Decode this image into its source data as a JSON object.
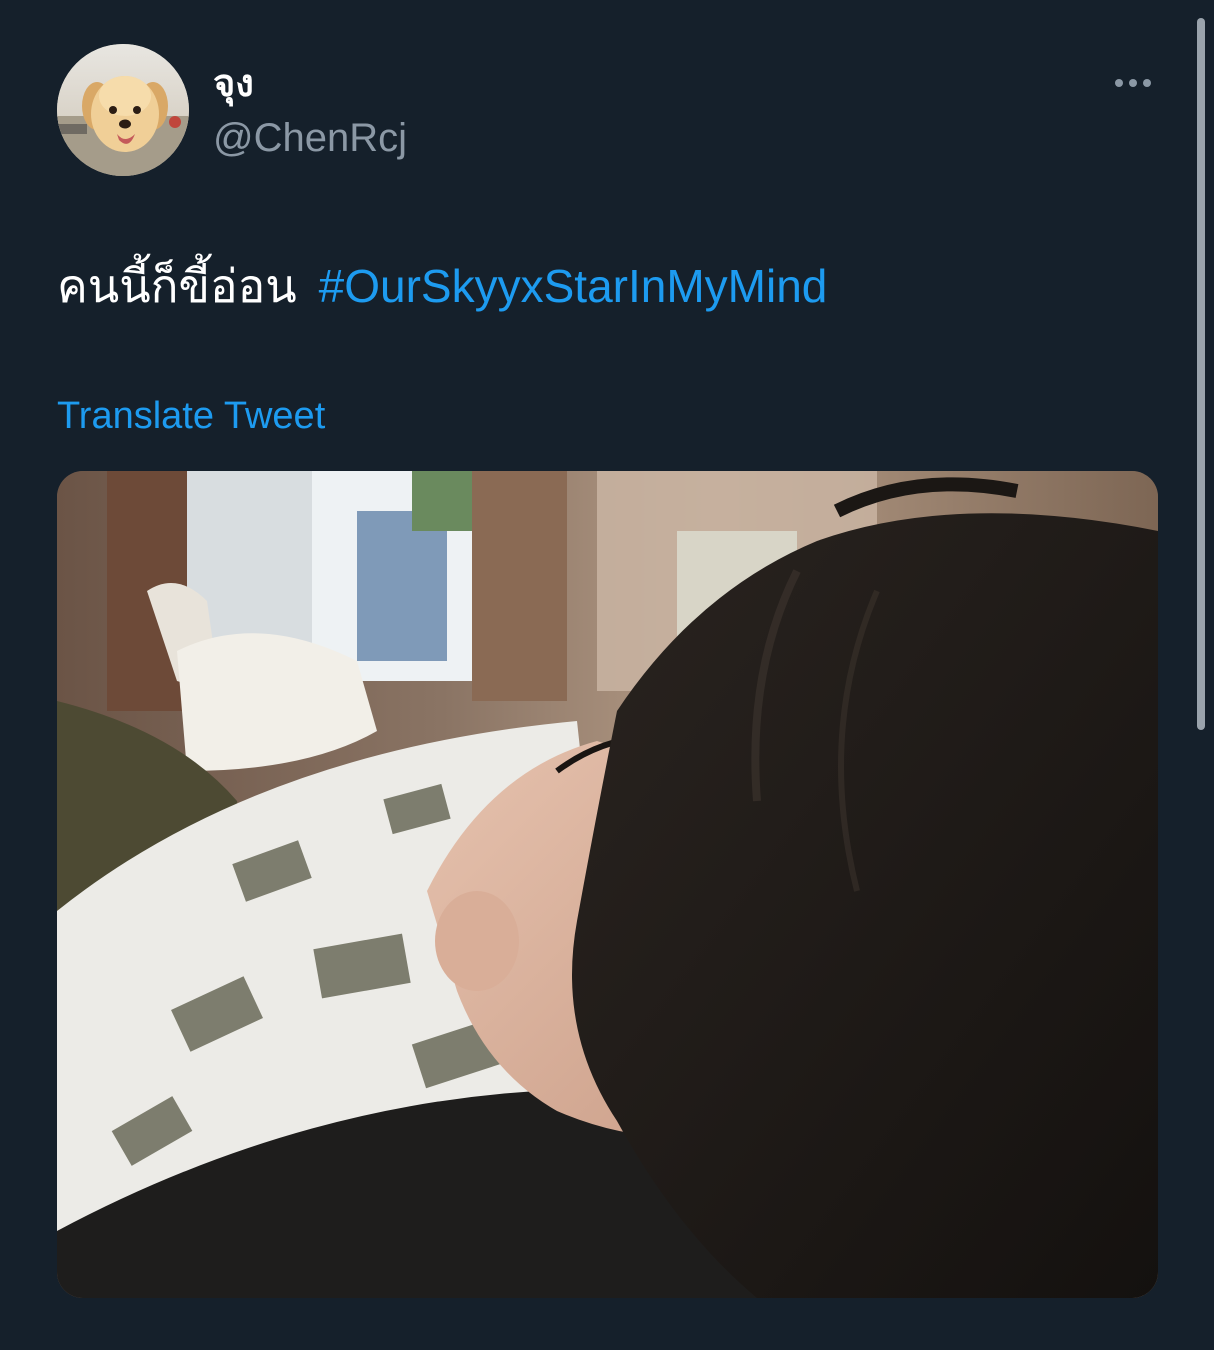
{
  "tweet": {
    "author": {
      "display_name": "จุง",
      "handle": "@ChenRcj",
      "avatar_description": "avatar"
    },
    "text": "คนนี้ก็ขี้อ่อน",
    "hashtag": "#OurSkyyxStarInMyMind",
    "translate_label": "Translate Tweet",
    "more_icon": "more-horizontal-icon"
  },
  "colors": {
    "background": "#15202b",
    "primary_text": "#ffffff",
    "secondary_text": "#8b98a5",
    "link": "#1d9bf0"
  }
}
